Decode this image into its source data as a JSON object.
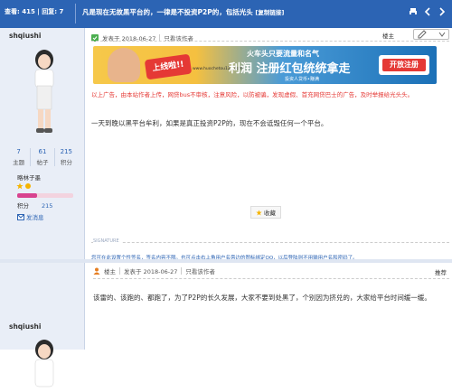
{
  "header": {
    "stats": "查看: 415 | 回复: 7",
    "title": "凡是现在无故黑平台的，一律是不投资P2P的，包括光头",
    "copy_link": "[复制链接]",
    "icons": [
      "print-icon",
      "prev-thread-icon",
      "next-thread-icon"
    ]
  },
  "post1": {
    "author": {
      "name": "shqiushi",
      "stats": [
        {
          "value": "7",
          "label": "主题"
        },
        {
          "value": "61",
          "label": "帖子"
        },
        {
          "value": "215",
          "label": "积分"
        }
      ],
      "rank": "略林子墨",
      "rank_progress": 0.35,
      "score_label": "积分",
      "score_value": "215",
      "message_label": "发消息"
    },
    "meta": {
      "posted": "发表于 2018-06-27",
      "only_author": "只看该作者"
    },
    "floor": "楼主",
    "banner": {
      "headline": "上线啦!!",
      "site": "www.huochetou123.com",
      "top_line": "火车头只要流量和名气",
      "main_line": "利润  注册红包统统拿走",
      "foot_line": "投资人贷币•赚满",
      "button": "开放注册"
    },
    "notice": "以上广告，由本站作者上传，网贷bus不审核，注意风险，以防被骗，发现虚假、首充网贷巴士的广告，及时举报给光头头。",
    "content": "一天到晚以黑平台牟利，如果是真正投资P2P的，现在不会诋毁任何一个平台。",
    "favorite": "收藏",
    "sig_label": "SIGNATURE",
    "signature": "您可在此设置个性签名，签名内容不限。也可点击右上角用户名旁边的图标绑定QQ，以后登陆则不用输用户名和密码了。",
    "reply": "回复",
    "report": "举报"
  },
  "post2": {
    "author": {
      "name": "shqiushi"
    },
    "meta": {
      "floor_owner": "楼主",
      "posted": "发表于 2018-06-27",
      "only_author": "只看该作者"
    },
    "floor": "推荐",
    "content": "该雷的、该跑的、都跑了，为了P2P的长久发展，大家不要到处黑了，个别因为挤兑的，大家给平台时间缓一缓。"
  }
}
